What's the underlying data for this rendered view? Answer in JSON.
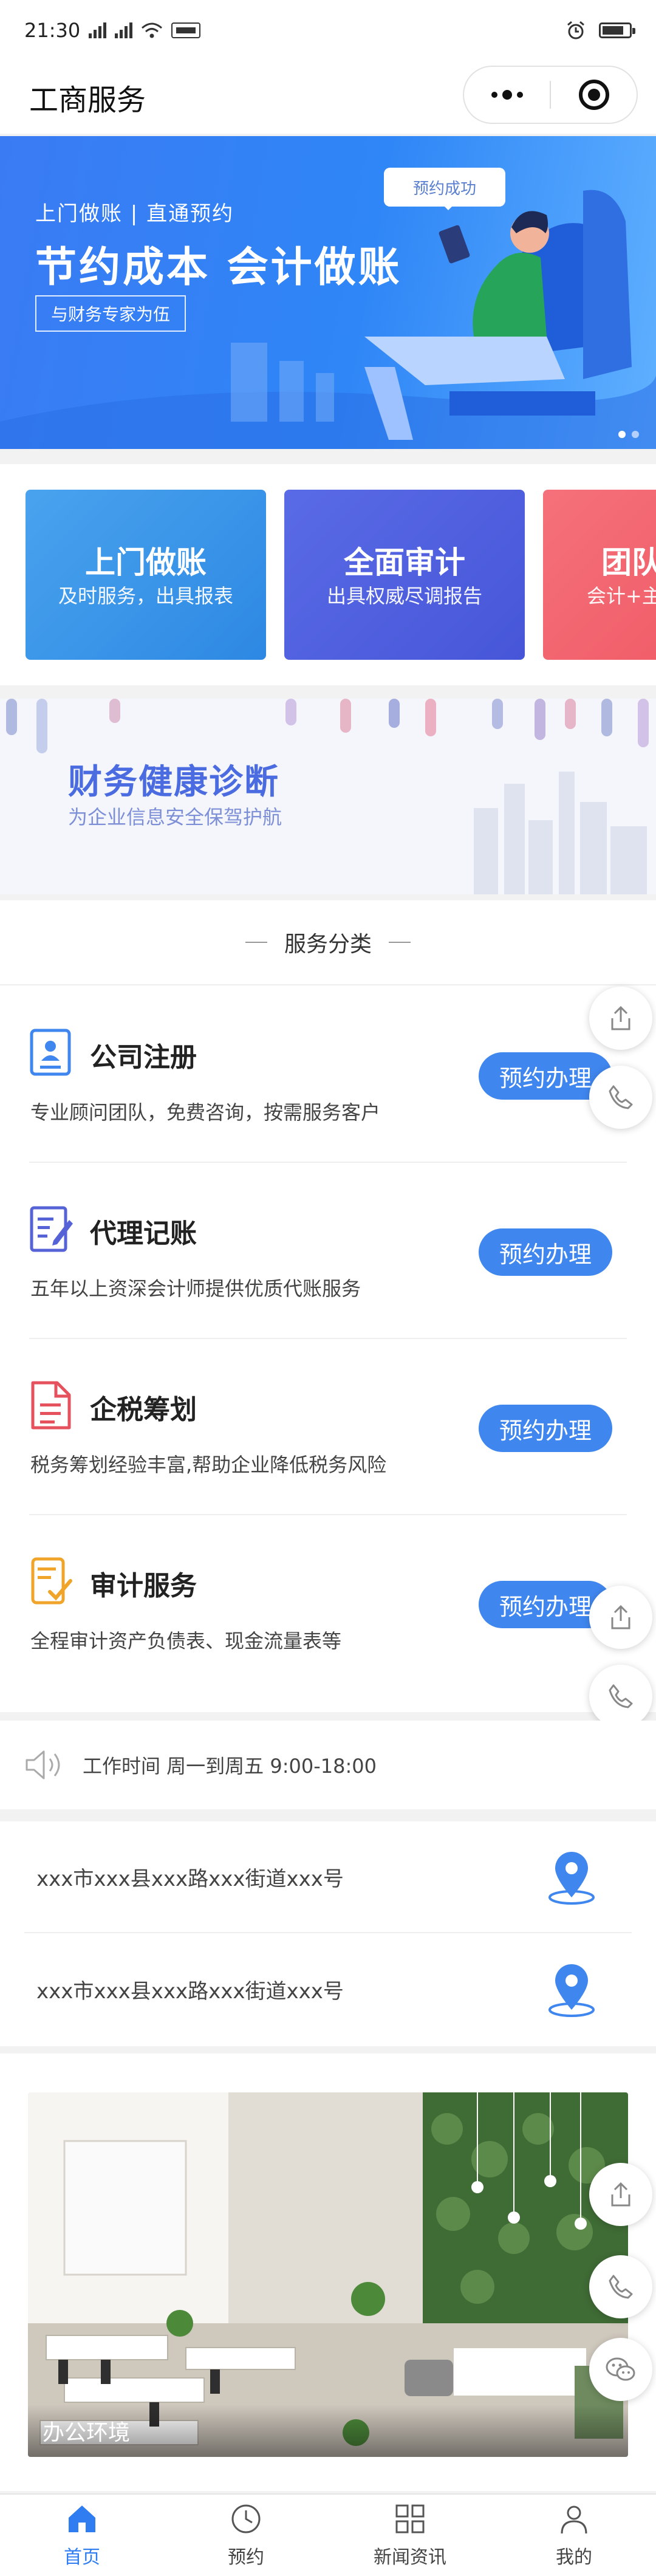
{
  "status_bar": {
    "time": "21:30"
  },
  "nav": {
    "title": "工商服务"
  },
  "banner": {
    "subtitle": "上门做账 | 直通预约",
    "headline": "节约成本 会计做账",
    "tag": "与财务专家为伍",
    "bubble": "预约成功"
  },
  "feature_cards": [
    {
      "title": "上门做账",
      "desc": "及时服务，出具报表"
    },
    {
      "title": "全面审计",
      "desc": "出具权威尽调报告"
    },
    {
      "title": "团队",
      "desc": "会计+主"
    }
  ],
  "diagnosis": {
    "title": "财务健康诊断",
    "desc": "为企业信息安全保驾护航"
  },
  "services": {
    "heading": "服务分类",
    "items": [
      {
        "title": "公司注册",
        "desc": "专业顾问团队，免费咨询，按需服务客户",
        "button": "预约办理"
      },
      {
        "title": "代理记账",
        "desc": "五年以上资深会计师提供优质代账服务",
        "button": "预约办理"
      },
      {
        "title": "企税筹划",
        "desc": "税务筹划经验丰富,帮助企业降低税务风险",
        "button": "预约办理"
      },
      {
        "title": "审计服务",
        "desc": "全程审计资产负债表、现金流量表等",
        "button": "预约办理"
      }
    ]
  },
  "work_time": "工作时间 周一到周五 9:00-18:00",
  "addresses": [
    "xxx市xxx县xxx路xxx街道xxx号",
    "xxx市xxx县xxx路xxx街道xxx号"
  ],
  "photo": {
    "caption": "办公环境"
  },
  "tabbar": [
    {
      "label": "首页",
      "icon": "home-icon",
      "active": true
    },
    {
      "label": "预约",
      "icon": "clock-icon",
      "active": false
    },
    {
      "label": "新闻资讯",
      "icon": "grid-icon",
      "active": false
    },
    {
      "label": "我的",
      "icon": "user-icon",
      "active": false
    }
  ],
  "colors": {
    "accent": "#3f86ee",
    "tab_active": "#2f7df0"
  }
}
